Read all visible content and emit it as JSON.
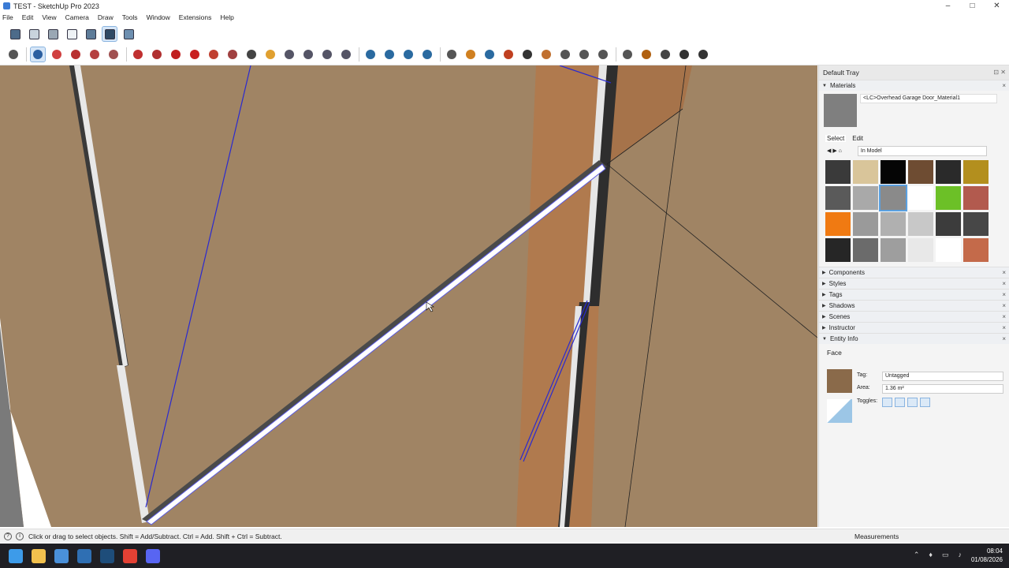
{
  "window": {
    "title": "TEST - SketchUp Pro 2023",
    "controls": [
      "–",
      "□",
      "✕"
    ]
  },
  "menu": [
    "File",
    "Edit",
    "View",
    "Camera",
    "Draw",
    "Tools",
    "Window",
    "Extensions",
    "Help"
  ],
  "toolbar_top": [
    "xray-icon",
    "back-edges-icon",
    "wireframe-icon",
    "hidden-line-icon",
    "shaded-icon",
    "shaded-textures-icon",
    "monochrome-icon"
  ],
  "toolbar_main": [
    "search-icon",
    "select-icon",
    "eraser-icon",
    "line-icon",
    "shape-icon",
    "rectangle-icon",
    "push-pull-icon",
    "follow-me-icon",
    "move-icon",
    "rotate-icon",
    "scale-icon",
    "offset-icon",
    "tape-icon",
    "protractor-icon",
    "orbit-icon",
    "pan-icon",
    "zoom-icon",
    "zoom-extents-icon",
    "section-icon",
    "section-display-icon",
    "section-fill-icon",
    "section-cut-icon",
    "account-icon",
    "3d-warehouse-icon",
    "extension-warehouse-icon",
    "layout-icon",
    "sandbox-icon",
    "photo-icon",
    "map-icon",
    "mesh-icon",
    "cloud-icon",
    "settings-icon",
    "solid-tools-icon",
    "info-icon",
    "cart-icon",
    "profile-icon"
  ],
  "tray": {
    "title": "Default Tray",
    "materials": {
      "header": "Materials",
      "current_name": "<LC>Overhead Garage Door_Material1",
      "tabs": [
        "Select",
        "Edit"
      ],
      "collection": "In Model",
      "swatches": [
        "#3a3a3a",
        "#d9c59a",
        "#050505",
        "#6e4c32",
        "#2a2a2a",
        "#b38f1e",
        "#5a5a5a",
        "#a9a9a9",
        "#8a8a8a",
        "#ffffff",
        "#6cc027",
        "#b25a4e",
        "#f07a12",
        "#9a9a9a",
        "#b0b0b0",
        "#c8c8c8",
        "#3c3c3c",
        "#474747",
        "#262626",
        "#6b6b6b",
        "#9e9e9e",
        "#e8e8e8",
        "#ffffff",
        "#c46a4a"
      ],
      "selected_swatch": 8
    },
    "panels": [
      "Components",
      "Styles",
      "Tags",
      "Shadows",
      "Scenes",
      "Instructor",
      "Entity Info"
    ],
    "entity": {
      "type": "Face",
      "tag_label": "Tag:",
      "tag_value": "Untagged",
      "area_label": "Area:",
      "area_value": "1.36 m²",
      "toggles_label": "Toggles:"
    }
  },
  "status": {
    "message": "Click or drag to select objects. Shift = Add/Subtract. Ctrl = Add. Shift + Ctrl = Subtract.",
    "measurements_label": "Measurements"
  },
  "taskbar": {
    "apps": [
      "windows-start-icon",
      "file-explorer-icon",
      "app-icon-1",
      "app-icon-2",
      "sketchup-icon",
      "chrome-icon",
      "discord-icon"
    ],
    "time": "08:04",
    "date": "01/08/2026"
  },
  "colors": {
    "viewport": "#a08464",
    "accent": "#3a7bd5"
  }
}
